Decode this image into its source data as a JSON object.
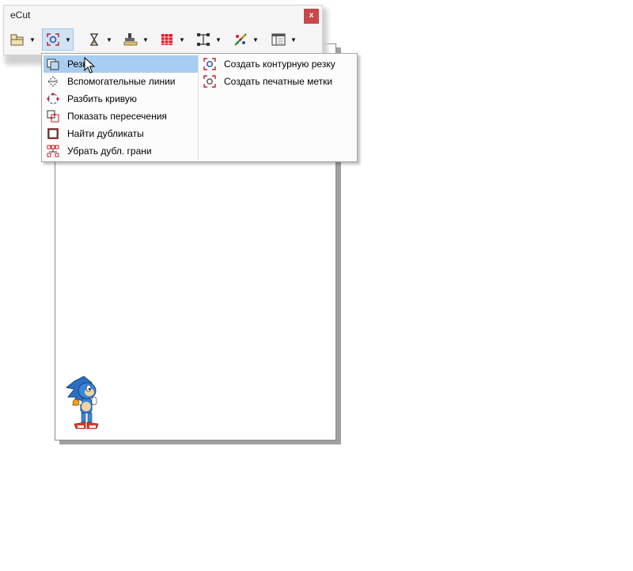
{
  "window": {
    "title": "eCut",
    "close_label": "x"
  },
  "toolbar": {
    "tools": [
      {
        "name": "layout-tool",
        "icon": "layout-icon"
      },
      {
        "name": "cut-tool",
        "icon": "cut-target-icon",
        "active": true
      },
      {
        "name": "hourglass-tool",
        "icon": "hourglass-icon"
      },
      {
        "name": "stamp-tool",
        "icon": "stamp-icon"
      },
      {
        "name": "table-tool",
        "icon": "red-grid-icon"
      },
      {
        "name": "nodes-tool",
        "icon": "nodes-icon"
      },
      {
        "name": "color-tool",
        "icon": "color-dots-icon"
      },
      {
        "name": "panel-tool",
        "icon": "panel-icon"
      }
    ],
    "dropdown_glyph": "▼"
  },
  "menu": {
    "left_items": [
      {
        "label": "Резка",
        "icon": "cut-icon",
        "highlighted": true
      },
      {
        "label": "Вспомогательные линии",
        "icon": "guide-lines-icon"
      },
      {
        "label": "Разбить кривую",
        "icon": "split-curve-icon"
      },
      {
        "label": "Показать пересечения",
        "icon": "intersections-icon"
      },
      {
        "label": "Найти дубликаты",
        "icon": "duplicates-icon"
      },
      {
        "label": "Убрать дубл. грани",
        "icon": "remove-dup-edges-icon"
      }
    ],
    "right_items": [
      {
        "label": "Создать контурную резку",
        "icon": "contour-cut-icon"
      },
      {
        "label": "Создать печатные метки",
        "icon": "print-marks-icon"
      }
    ]
  },
  "colors": {
    "accent": "#a7cdf0",
    "close": "#c9474a",
    "icon_red": "#c8202a"
  }
}
